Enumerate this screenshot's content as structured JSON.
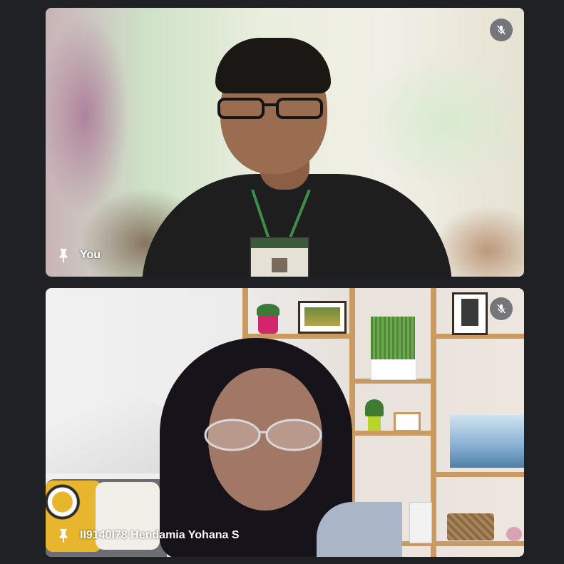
{
  "participants": [
    {
      "name": "You",
      "muted": true,
      "pinned": true
    },
    {
      "name": "II9140I78 Hendamia Yohana S",
      "muted": true,
      "pinned": true
    }
  ],
  "icons": {
    "mic_off": "mic-off-icon",
    "pin": "pin-icon"
  },
  "colors": {
    "background": "#202124",
    "overlay": "#5f6368",
    "label": "#ffffff"
  }
}
